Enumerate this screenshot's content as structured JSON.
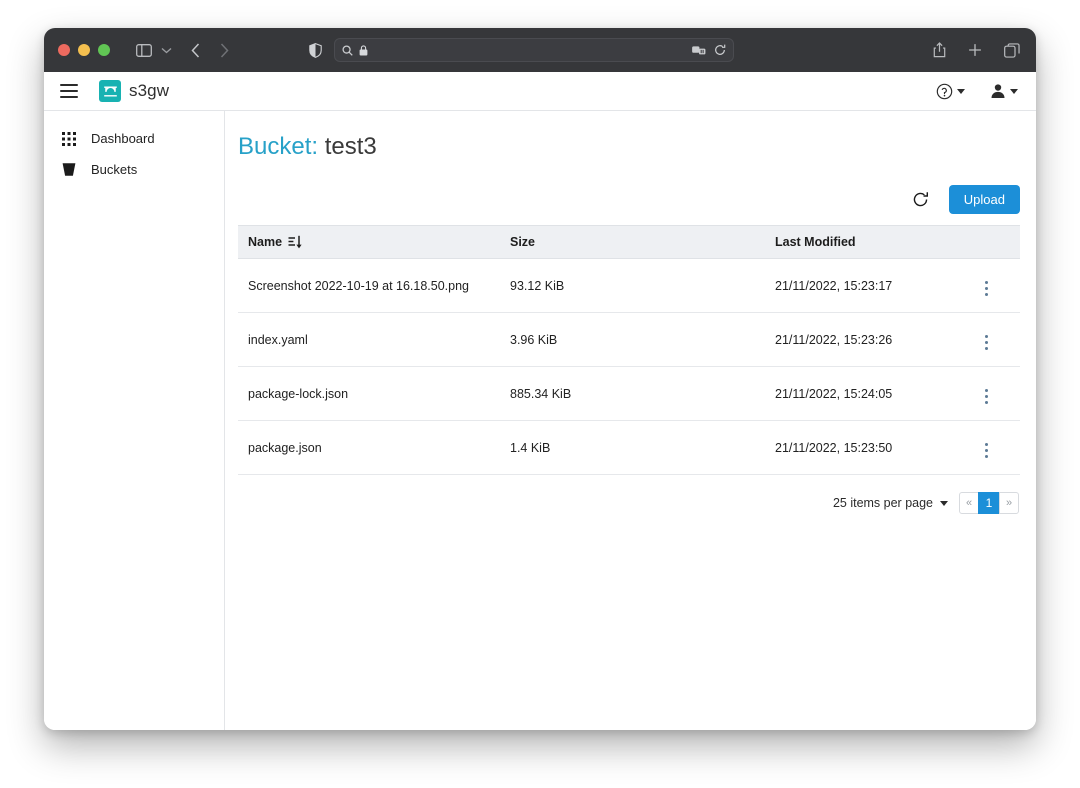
{
  "browser": {
    "traffic_lights": [
      "close",
      "minimize",
      "maximize"
    ],
    "address_value": "",
    "address_placeholder": "",
    "icons": {
      "sidebar": "sidebar-toggle-icon",
      "caret": "chevron-down-icon",
      "back": "back-arrow-icon",
      "forward": "forward-arrow-icon",
      "shield": "privacy-shield-icon",
      "search": "search-icon",
      "lock": "lock-icon",
      "extensions": "extensions-icon",
      "reload": "reload-icon",
      "share": "share-icon",
      "new_tab": "plus-icon",
      "tab_overview": "tab-overview-icon"
    }
  },
  "appbar": {
    "menu_icon": "hamburger-menu-icon",
    "logo_icon": "s3gw-logo-icon",
    "brand": "s3gw",
    "help_icon": "help-circle-icon",
    "user_icon": "user-avatar-icon"
  },
  "sidebar": {
    "items": [
      {
        "label": "Dashboard",
        "icon": "grid-icon"
      },
      {
        "label": "Buckets",
        "icon": "bucket-icon"
      }
    ]
  },
  "main": {
    "title_prefix": "Bucket:",
    "title_name": "test3",
    "toolbar": {
      "refresh_icon": "refresh-icon",
      "upload_label": "Upload"
    },
    "table": {
      "columns": [
        {
          "label": "Name",
          "sort": "sort-descending-icon"
        },
        {
          "label": "Size"
        },
        {
          "label": "Last Modified"
        }
      ],
      "rows": [
        {
          "name": "Screenshot 2022-10-19 at 16.18.50.png",
          "size": "93.12 KiB",
          "modified": "21/11/2022, 15:23:17",
          "menu_icon": "kebab-menu-icon"
        },
        {
          "name": "index.yaml",
          "size": "3.96 KiB",
          "modified": "21/11/2022, 15:23:26",
          "menu_icon": "kebab-menu-icon"
        },
        {
          "name": "package-lock.json",
          "size": "885.34 KiB",
          "modified": "21/11/2022, 15:24:05",
          "menu_icon": "kebab-menu-icon"
        },
        {
          "name": "package.json",
          "size": "1.4 KiB",
          "modified": "21/11/2022, 15:23:50",
          "menu_icon": "kebab-menu-icon"
        }
      ]
    },
    "pagination": {
      "per_page_label": "25 items per page",
      "prev_label": "«",
      "current_page": "1",
      "next_label": "»"
    }
  },
  "colors": {
    "accent_blue": "#1c8fd8",
    "title_accent": "#27a1c8",
    "brand_teal": "#18b2b2",
    "titlebar": "#36373a",
    "table_header_bg": "#eef0f3"
  }
}
